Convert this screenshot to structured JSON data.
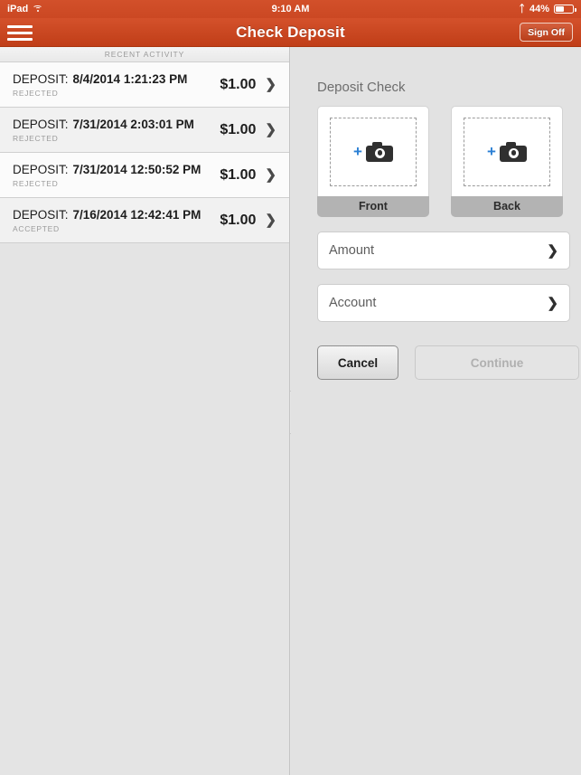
{
  "status_bar": {
    "device": "iPad",
    "wifi_icon": "wifi-icon",
    "time": "9:10 AM",
    "bluetooth_icon": "bluetooth-icon",
    "battery_percent": "44%",
    "battery_icon": "battery-icon"
  },
  "nav": {
    "menu_icon": "hamburger-menu-icon",
    "title": "Check Deposit",
    "sign_off": "Sign Off"
  },
  "sidebar": {
    "header": "RECENT ACTIVITY",
    "rows": [
      {
        "label": "DEPOSIT:",
        "date": "8/4/2014 1:21:23 PM",
        "status": "REJECTED",
        "amount": "$1.00"
      },
      {
        "label": "DEPOSIT:",
        "date": "7/31/2014 2:03:01 PM",
        "status": "REJECTED",
        "amount": "$1.00"
      },
      {
        "label": "DEPOSIT:",
        "date": "7/31/2014 12:50:52 PM",
        "status": "REJECTED",
        "amount": "$1.00"
      },
      {
        "label": "DEPOSIT:",
        "date": "7/16/2014 12:42:41 PM",
        "status": "ACCEPTED",
        "amount": "$1.00"
      }
    ]
  },
  "splitter": {
    "handle_icon": "drag-handle-icon"
  },
  "main": {
    "section_title": "Deposit Check",
    "captures": [
      {
        "caption": "Front",
        "icon": "camera-add-icon"
      },
      {
        "caption": "Back",
        "icon": "camera-add-icon"
      }
    ],
    "fields": [
      {
        "label": "Amount",
        "chevron": "›"
      },
      {
        "label": "Account",
        "chevron": "›"
      }
    ],
    "buttons": {
      "cancel": "Cancel",
      "continue": "Continue"
    }
  },
  "colors": {
    "brand_orange": "#cb4823",
    "accent_blue": "#2a7fd4",
    "panel_gray": "#e2e2e2",
    "caption_gray": "#b3b3b3"
  }
}
